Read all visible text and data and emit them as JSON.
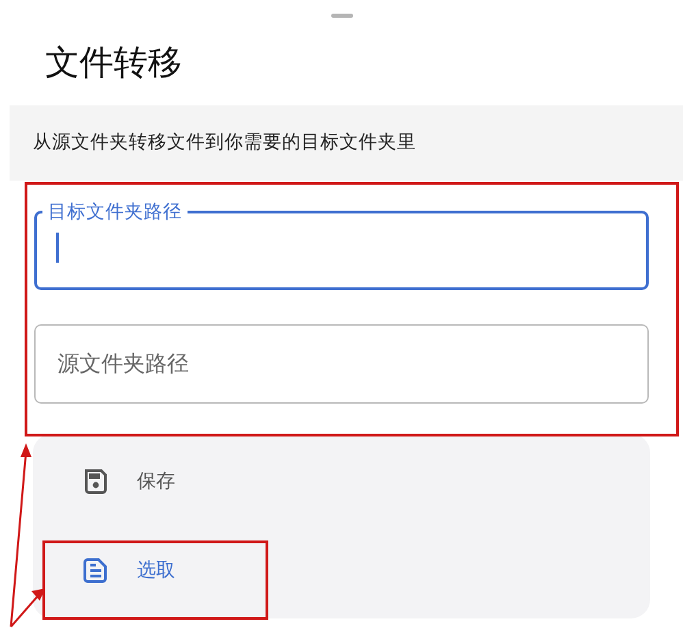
{
  "title": "文件转移",
  "description": "从源文件夹转移文件到你需要的目标文件夹里",
  "fields": [
    {
      "label": "目标文件夹路径",
      "focused": true
    },
    {
      "label": "源文件夹路径",
      "focused": false
    }
  ],
  "actions": [
    {
      "kind": "save",
      "label": "保存",
      "selected": false
    },
    {
      "kind": "pick",
      "label": "选取",
      "selected": true
    }
  ]
}
